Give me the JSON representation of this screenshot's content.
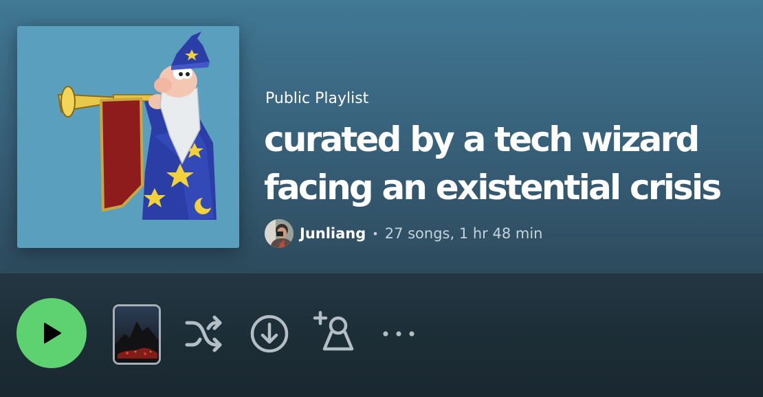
{
  "playlist": {
    "type_label": "Public Playlist",
    "title": "curated by a tech wizard facing an existential crisis",
    "owner": "Junliang",
    "separator": "•",
    "stats": "27 songs, 1 hr 48 min"
  },
  "icons": {
    "cover": "wizard-with-trumpet-art",
    "play": "play-icon",
    "shuffle": "shuffle-icon",
    "download": "download-circle-icon",
    "add_user": "add-user-icon",
    "more": "more-options-icon"
  },
  "colors": {
    "header_bg": "#417894",
    "actions_bg": "#1c2d36",
    "play_button": "#5ed170",
    "cover_bg": "#5b9fbf",
    "icon_gray": "#b3bec5"
  }
}
